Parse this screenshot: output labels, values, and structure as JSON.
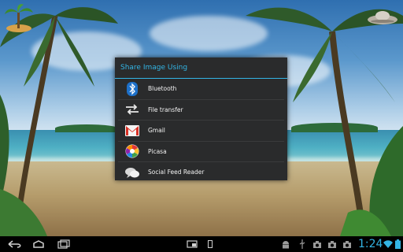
{
  "dialog": {
    "title": "Share Image Using",
    "items": [
      {
        "label": "Bluetooth",
        "icon": "bluetooth-icon"
      },
      {
        "label": "File transfer",
        "icon": "file-transfer-icon"
      },
      {
        "label": "Gmail",
        "icon": "gmail-icon"
      },
      {
        "label": "Picasa",
        "icon": "picasa-icon"
      },
      {
        "label": "Social Feed Reader",
        "icon": "social-feed-reader-icon"
      }
    ]
  },
  "statusbar": {
    "time": "1:24"
  },
  "colors": {
    "accent": "#33b5e5",
    "dialog_bg": "#2a2b2c"
  }
}
